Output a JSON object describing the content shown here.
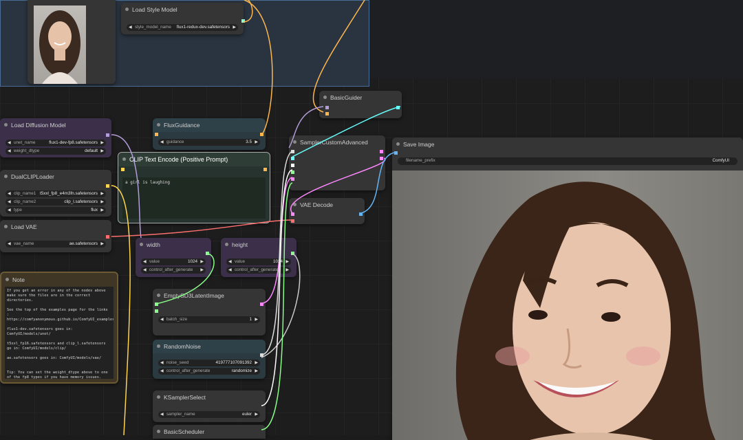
{
  "load_style_model": {
    "title": "Load Style Model",
    "widgets": [
      {
        "label": "style_model_name",
        "value": "flux1-redux-dev.safetensors"
      }
    ]
  },
  "load_diffusion_model": {
    "title": "Load Diffusion Model",
    "widgets": [
      {
        "label": "unet_name",
        "value": "flux1-dev-fp8.safetensors"
      },
      {
        "label": "weight_dtype",
        "value": "default"
      }
    ]
  },
  "dual_clip_loader": {
    "title": "DualCLIPLoader",
    "widgets": [
      {
        "label": "clip_name1",
        "value": "t5xxl_fp8_e4m3fn.safetensors"
      },
      {
        "label": "clip_name2",
        "value": "clip_l.safetensors"
      },
      {
        "label": "type",
        "value": "flux"
      }
    ]
  },
  "load_vae": {
    "title": "Load VAE",
    "widgets": [
      {
        "label": "vae_name",
        "value": "ae.safetensors"
      }
    ]
  },
  "note": {
    "title": "Note",
    "text": "If you get an error in any of the nodes above make sure the files are in the correct directories.\n\nSee the top of the examples page for the links : https://comfyanonymous.github.io/ComfyUI_examples/flux/\n\nflux1-dev.safetensors goes in: ComfyUI/models/unet/\n\nt5xxl_fp16.safetensors and clip_l.safetensors go in: ComfyUI/models/clip/\n\nae.safetensors goes in: ComfyUI/models/vae/\n\n\nTip: You can set the weight_dtype above to one of the fp8 types if you have memory issues."
  },
  "flux_guidance": {
    "title": "FluxGuidance",
    "widgets": [
      {
        "label": "guidance",
        "value": "3.5"
      }
    ]
  },
  "clip_text_encode": {
    "title": "CLIP Text Encode (Positive Prompt)",
    "text": "a girl is laughing"
  },
  "width_node": {
    "title": "width",
    "widgets": [
      {
        "label": "value",
        "value": "1024"
      },
      {
        "label": "control_after_generate",
        "value": ""
      }
    ]
  },
  "height_node": {
    "title": "height",
    "widgets": [
      {
        "label": "value",
        "value": "1024"
      },
      {
        "label": "control_after_generate",
        "value": ""
      }
    ]
  },
  "empty_latent": {
    "title": "EmptySD3LatentImage",
    "widgets": [
      {
        "label": "batch_size",
        "value": "1"
      }
    ]
  },
  "random_noise": {
    "title": "RandomNoise",
    "widgets": [
      {
        "label": "noise_seed",
        "value": "419777107091392"
      },
      {
        "label": "control_after_generate",
        "value": "randomize"
      }
    ]
  },
  "ksampler_select": {
    "title": "KSamplerSelect",
    "widgets": [
      {
        "label": "sampler_name",
        "value": "euler"
      }
    ]
  },
  "basic_scheduler": {
    "title": "BasicScheduler"
  },
  "basic_guider": {
    "title": "BasicGuider"
  },
  "sampler_custom": {
    "title": "SamplerCustomAdvanced"
  },
  "vae_decode": {
    "title": "VAE Decode"
  },
  "save_image": {
    "title": "Save Image",
    "widgets": [
      {
        "label": "filename_prefix",
        "value": "ComfyUI"
      }
    ]
  }
}
